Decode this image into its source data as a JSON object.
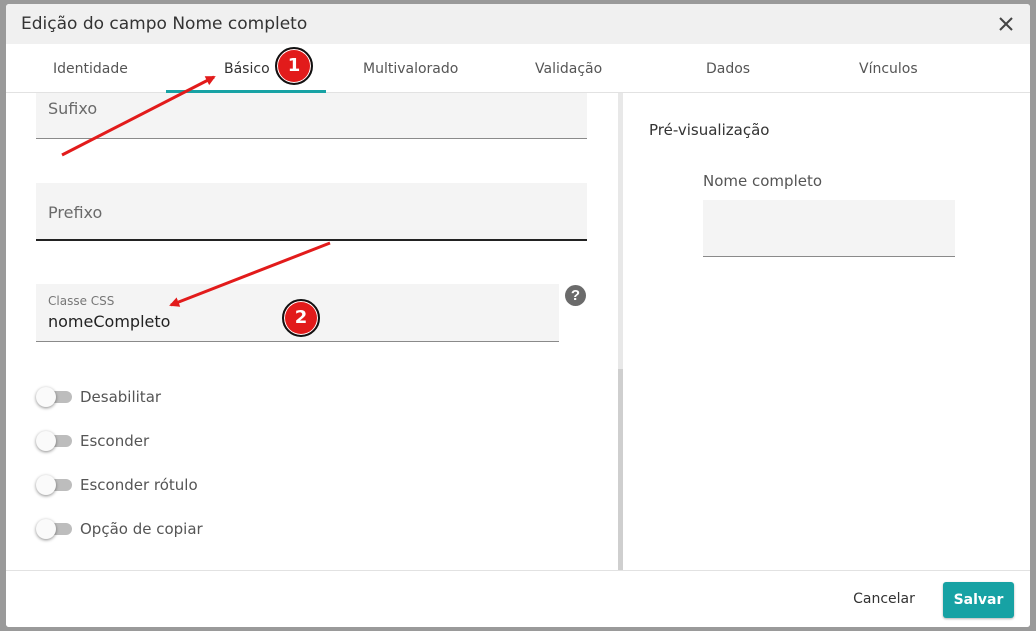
{
  "dialog": {
    "title": "Edição do campo Nome completo"
  },
  "tabs": [
    {
      "label": "Identidade",
      "active": false
    },
    {
      "label": "Básico",
      "active": true
    },
    {
      "label": "Multivalorado",
      "active": false
    },
    {
      "label": "Validação",
      "active": false
    },
    {
      "label": "Dados",
      "active": false
    },
    {
      "label": "Vínculos",
      "active": false
    }
  ],
  "form": {
    "sufixo": {
      "label": "Sufixo",
      "value": ""
    },
    "prefixo": {
      "label": "Prefixo",
      "value": ""
    },
    "classe_css": {
      "label": "Classe CSS",
      "value": "nomeCompleto"
    },
    "help_glyph": "?",
    "toggles": [
      {
        "label": "Desabilitar",
        "on": false
      },
      {
        "label": "Esconder",
        "on": false
      },
      {
        "label": "Esconder rótulo",
        "on": false
      },
      {
        "label": "Opção de copiar",
        "on": false
      }
    ]
  },
  "preview": {
    "title": "Pré-visualização",
    "field_label": "Nome completo",
    "field_value": ""
  },
  "footer": {
    "cancel_label": "Cancelar",
    "save_label": "Salvar"
  },
  "annotations": {
    "badge_1": "1",
    "badge_2": "2"
  },
  "colors": {
    "accent": "#17a2a4",
    "annotation_red": "#e21b1b"
  }
}
